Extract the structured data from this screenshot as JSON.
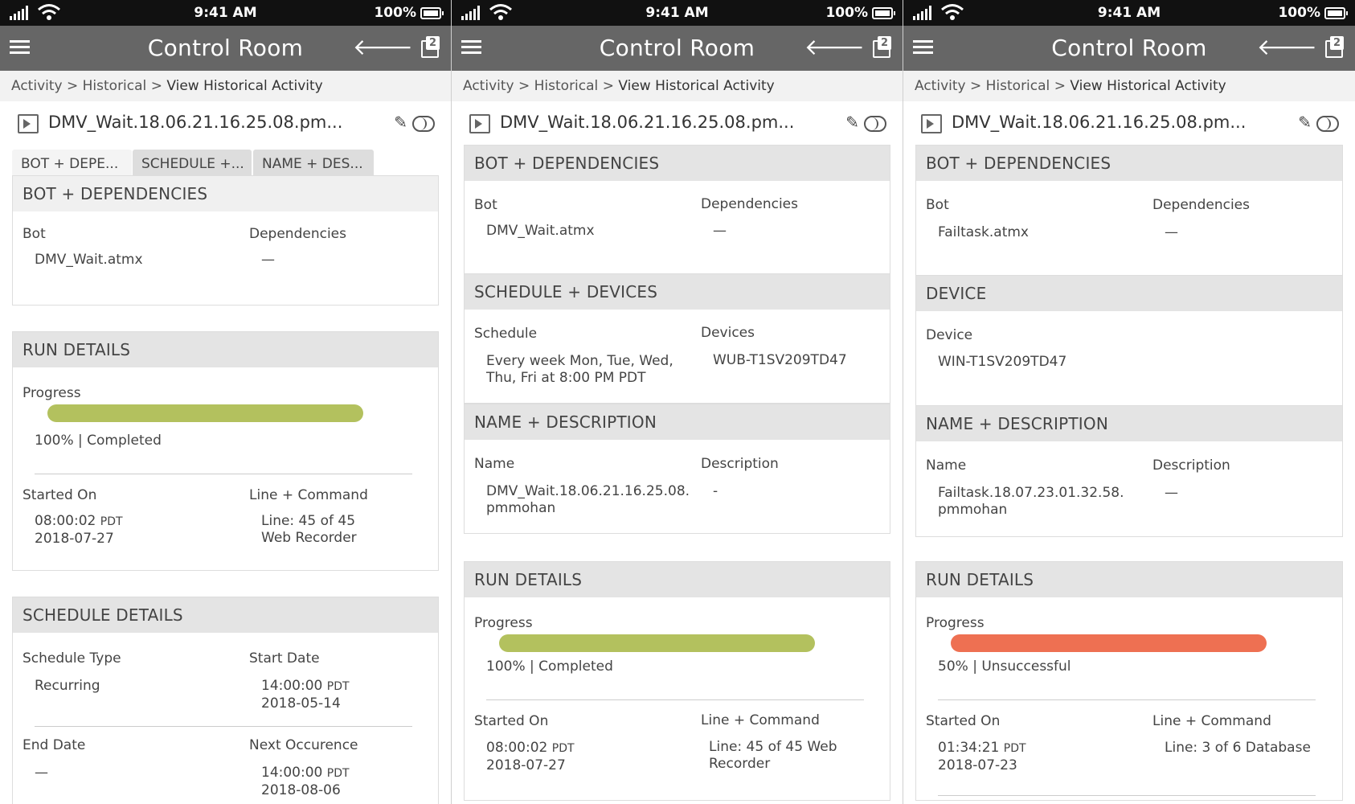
{
  "status": {
    "time": "9:41 AM",
    "battery": "100%"
  },
  "nav": {
    "title": "Control Room",
    "copies_count": "2"
  },
  "breadcrumb": {
    "activity": "Activity",
    "sep": ">",
    "historical": "Historical",
    "current": "View Historical Activity"
  },
  "labels": {
    "bot": "Bot",
    "dependencies": "Dependencies",
    "progress": "Progress",
    "started_on": "Started On",
    "line_command": "Line + Command",
    "schedule_type": "Schedule Type",
    "start_date": "Start Date",
    "end_date": "End Date",
    "next_occurence": "Next Occurence",
    "schedule": "Schedule",
    "devices": "Devices",
    "device": "Device",
    "name": "Name",
    "description": "Description"
  },
  "sections": {
    "bot_deps": "BOT + DEPENDENCIES",
    "run_details": "RUN DETAILS",
    "schedule_details": "SCHEDULE DETAILS",
    "schedule_devices": "SCHEDULE + DEVICES",
    "name_desc": "NAME + DESCRIPTION",
    "device": "DEVICE"
  },
  "colors": {
    "success": "#b3c15e",
    "failure": "#ee7052"
  },
  "screens": [
    {
      "file_name": "DMV_Wait.18.06.21.16.25.08.pm...",
      "tabs": [
        "BOT + DEPE...",
        "SCHEDULE +...",
        "NAME + DES..."
      ],
      "bot": "DMV_Wait.atmx",
      "dependencies": "—",
      "progress_pct": 100,
      "progress_text": "100% | Completed",
      "started_time": "08:00:02",
      "started_tz": "PDT",
      "started_date": "2018-07-27",
      "line": "Line: 45 of 45",
      "command": "Web Recorder",
      "schedule_type": "Recurring",
      "start_time": "14:00:00",
      "start_tz": "PDT",
      "start_date": "2018-05-14",
      "end_date": "—",
      "next_time": "14:00:00",
      "next_tz": "PDT",
      "next_date": "2018-08-06"
    },
    {
      "file_name": "DMV_Wait.18.06.21.16.25.08.pm...",
      "bot": "DMV_Wait.atmx",
      "dependencies": "—",
      "schedule_line1": "Every week Mon, Tue, Wed,",
      "schedule_line2": "Thu, Fri at 8:00 PM PDT",
      "devices": "WUB-T1SV209TD47",
      "name_line1": "DMV_Wait.18.06.21.16.25.08.",
      "name_line2": "pmmohan",
      "description": "-",
      "progress_pct": 100,
      "progress_text": "100% | Completed",
      "started_time": "08:00:02",
      "started_tz": "PDT",
      "started_date": "2018-07-27",
      "line": "Line: 45 of 45 Web",
      "command": "Recorder"
    },
    {
      "file_name": "DMV_Wait.18.06.21.16.25.08.pm...",
      "bot": "Failtask.atmx",
      "dependencies": "—",
      "device": "WIN-T1SV209TD47",
      "name_line1": "Failtask.18.07.23.01.32.58.",
      "name_line2": "pmmohan",
      "description": "—",
      "progress_pct": 50,
      "progress_text": "50% | Unsuccessful",
      "started_time": "01:34:21",
      "started_tz": "PDT",
      "started_date": "2018-07-23",
      "line": "Line: 3 of 6 Database"
    }
  ]
}
